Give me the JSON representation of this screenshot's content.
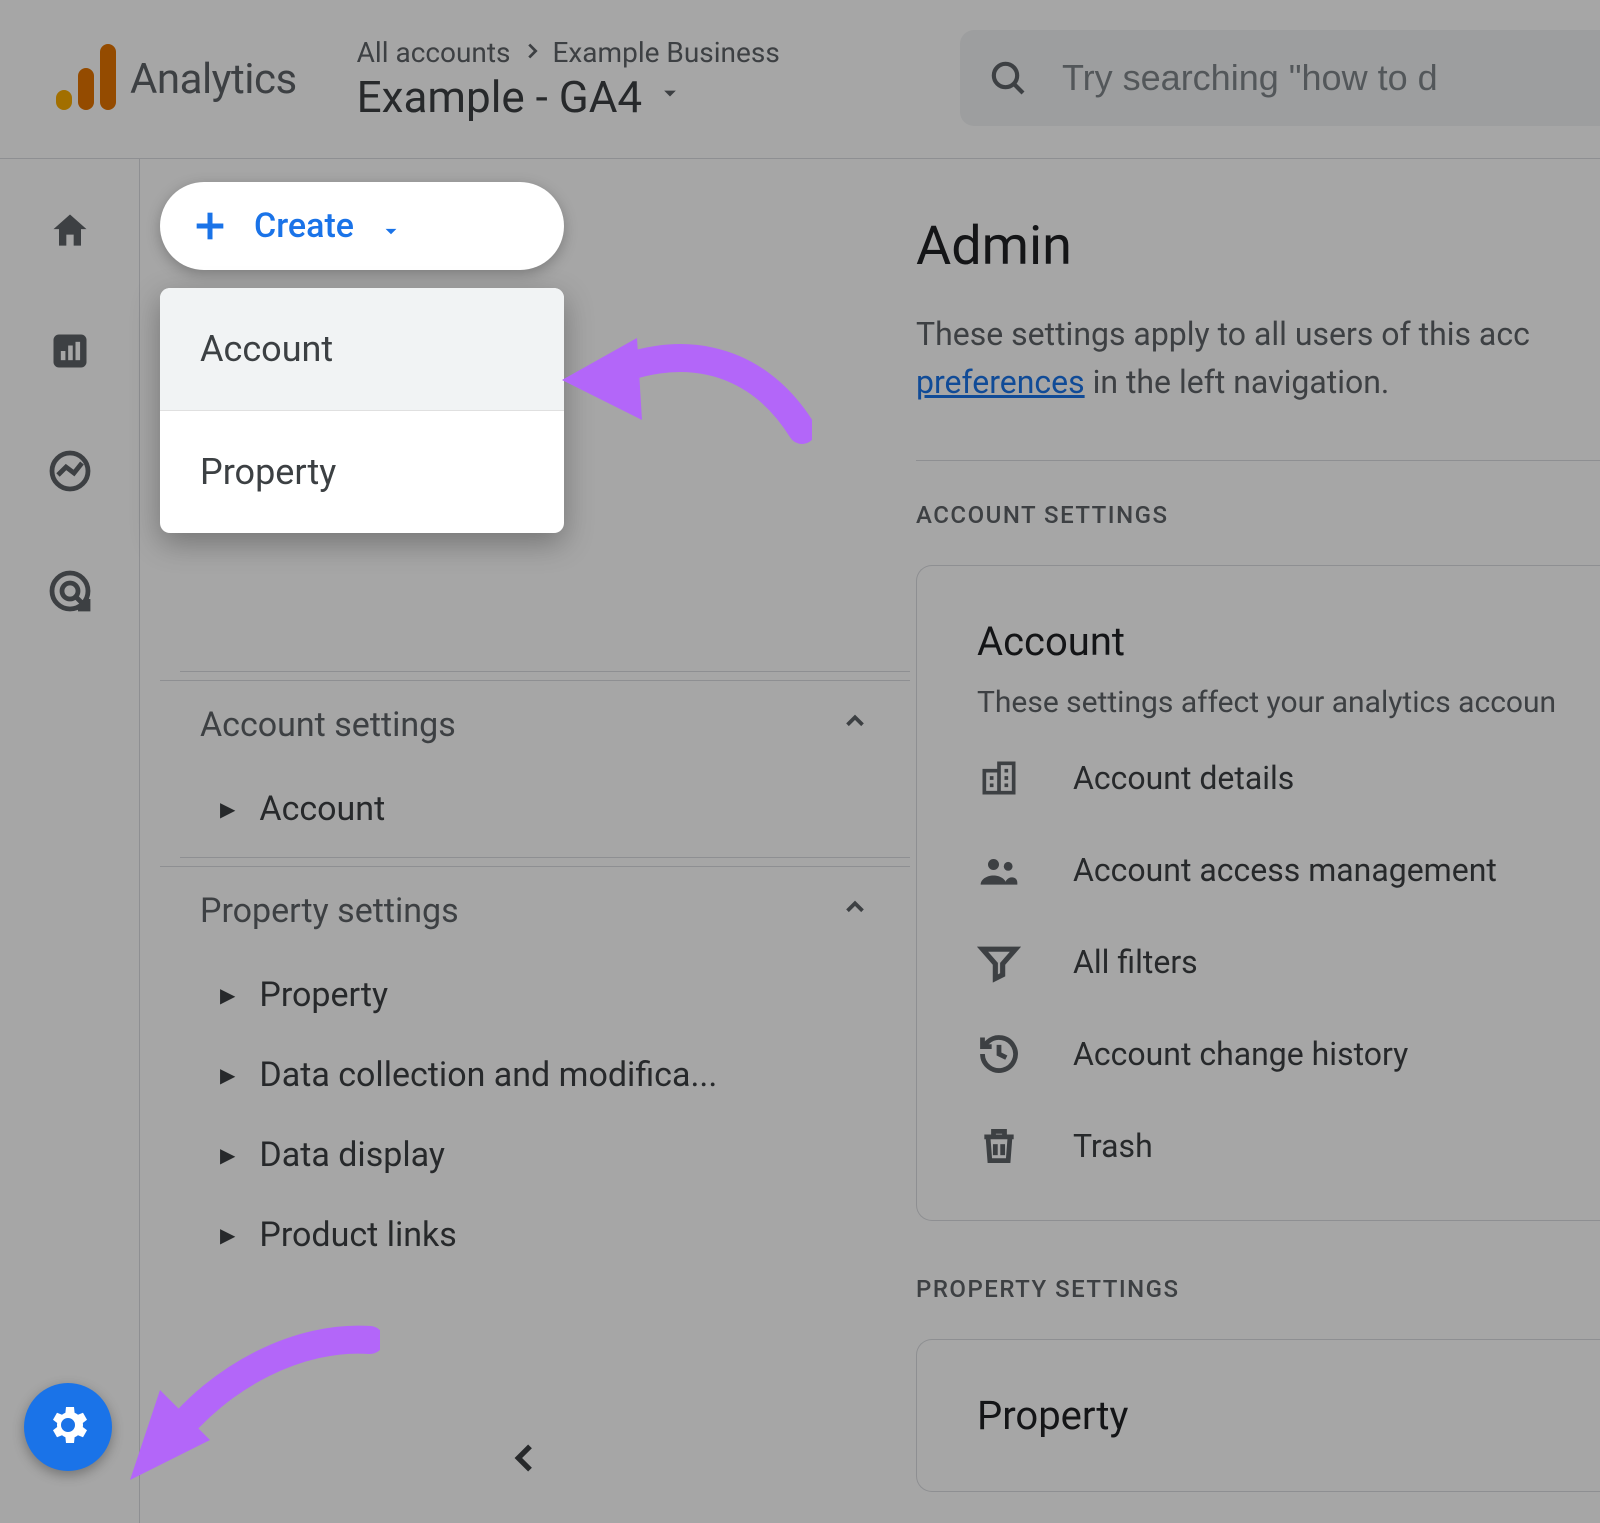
{
  "header": {
    "product": "Analytics",
    "account_path": {
      "all": "All accounts",
      "business": "Example Business"
    },
    "property": "Example - GA4",
    "search_placeholder": "Try searching \"how to d"
  },
  "create": {
    "label": "Create",
    "options": [
      "Account",
      "Property"
    ]
  },
  "left_panel": {
    "account_settings_label": "Account settings",
    "account_items": [
      "Account"
    ],
    "property_settings_label": "Property settings",
    "property_items": [
      "Property",
      "Data collection and modifica...",
      "Data display",
      "Product links"
    ]
  },
  "main": {
    "title": "Admin",
    "desc_1": "These settings apply to all users of this acc",
    "desc_link": "preferences",
    "desc_2": " in the left navigation.",
    "account_group_label": "ACCOUNT SETTINGS",
    "account_card": {
      "title": "Account",
      "desc": "These settings affect your analytics accoun",
      "rows": [
        "Account details",
        "Account access management",
        "All filters",
        "Account change history",
        "Trash"
      ]
    },
    "property_group_label": "PROPERTY SETTINGS",
    "property_card": {
      "title": "Property"
    }
  }
}
